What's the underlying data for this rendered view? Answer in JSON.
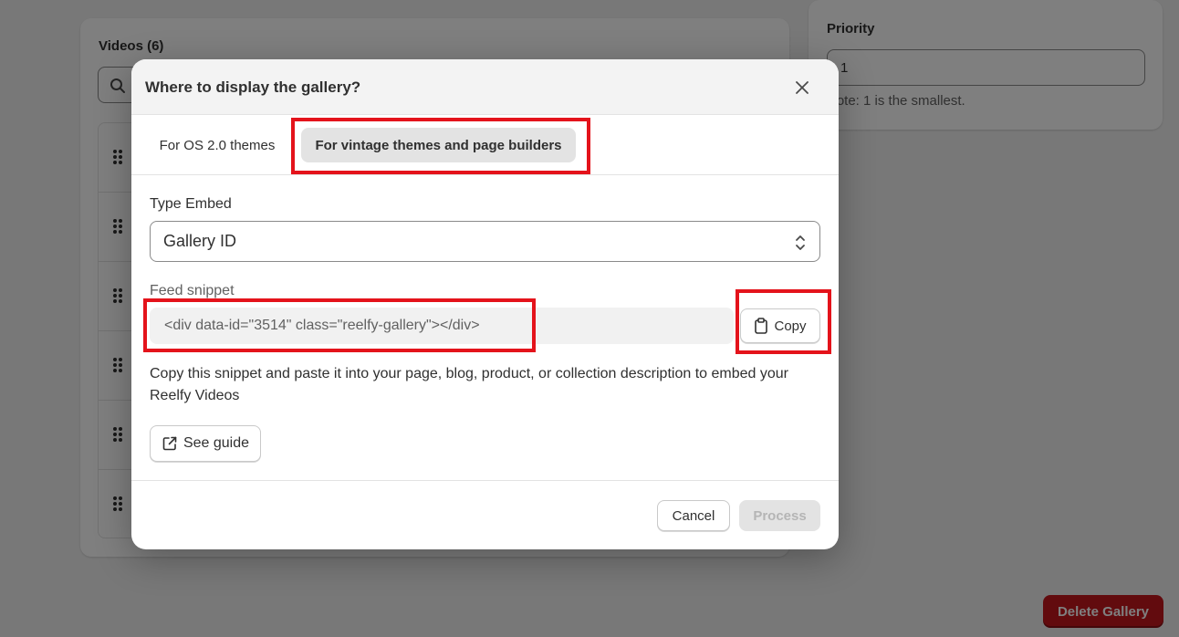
{
  "background": {
    "videos_title": "Videos (6)",
    "video_row_count": 6,
    "priority": {
      "label": "Priority",
      "value": "1",
      "note": "Note: 1 is the smallest."
    },
    "delete_button": "Delete Gallery"
  },
  "modal": {
    "title": "Where to display the gallery?",
    "tabs": [
      {
        "label": "For OS 2.0 themes",
        "active": false
      },
      {
        "label": "For vintage themes and page builders",
        "active": true
      }
    ],
    "type_embed": {
      "label": "Type Embed",
      "selected": "Gallery ID"
    },
    "feed_snippet": {
      "label": "Feed snippet",
      "code": "<div data-id=\"3514\" class=\"reelfy-gallery\"></div>",
      "copy_label": "Copy"
    },
    "help_text": "Copy this snippet and paste it into your page, blog, product, or collection description to embed your Reelfy Videos",
    "guide_label": "See guide",
    "footer": {
      "cancel": "Cancel",
      "process": "Process"
    }
  },
  "colors": {
    "highlight": "#e4131b",
    "danger": "#c5161d",
    "overlay": "rgba(0,0,0,0.5)"
  }
}
